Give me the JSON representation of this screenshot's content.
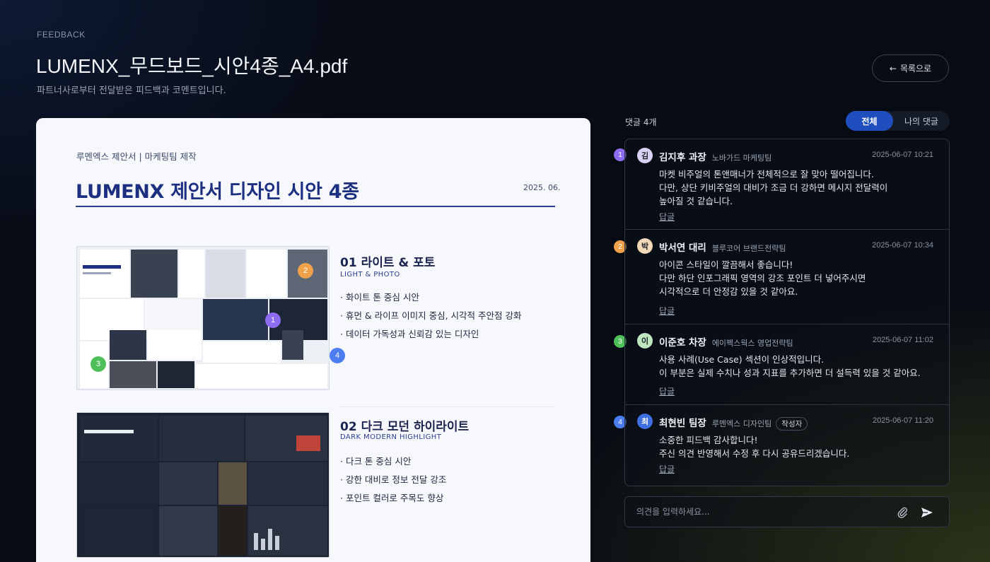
{
  "header": {
    "eyebrow": "FEEDBACK",
    "title": "LUMENX_무드보드_시안4종_A4.pdf",
    "subtitle": "파트너사로부터 전달받은 피드백과 코멘트입니다.",
    "back_label": "목록으로"
  },
  "document": {
    "eyebrow": "루멘엑스 제안서 | 마케팅팀 제작",
    "title": "LUMENX 제안서 디자인 시안 4종",
    "date": "2025. 06.",
    "sections": [
      {
        "heading": "01  라이트 & 포토",
        "sub": "LIGHT & PHOTO",
        "bullets": [
          "· 화이트 톤 중심 시안",
          "· 휴먼 & 라이프 이미지 중심, 시각적 주안점 강화",
          "· 데이터 가독성과 신뢰감 있는 디자인"
        ]
      },
      {
        "heading": "02  다크 모던 하이라이트",
        "sub": "DARK MODERN HIGHLIGHT",
        "bullets": [
          "· 다크 톤 중심 시안",
          "· 강한 대비로 정보 전달 강조",
          "· 포인트 컬러로 주목도 향상"
        ]
      }
    ],
    "pins": [
      "1",
      "2",
      "3",
      "4"
    ]
  },
  "comments_panel": {
    "count_label": "댓글 4개",
    "filter_all": "전체",
    "filter_mine": "나의 댓글",
    "comments": [
      {
        "pin": "1",
        "initial": "김",
        "name": "김지후 과장",
        "org": "노바가드 마케팅팀",
        "time": "2025-06-07 10:21",
        "text": "마켓 비주얼의 톤앤매너가 전체적으로 잘 맞아 떨어집니다.\n다만, 상단 키비주얼의 대비가 조금 더 강하면 메시지 전달력이\n높아질 것 같습니다.",
        "reply": "답글",
        "color": "#8e6cf0",
        "avatar_bg": "#d9d2f5"
      },
      {
        "pin": "2",
        "initial": "박",
        "name": "박서연 대리",
        "org": "블루코어 브랜드전략팀",
        "time": "2025-06-07 10:34",
        "text": "아이콘 스타일이 깔끔해서 좋습니다!\n다만 하단 인포그래픽 영역의 강조 포인트 더 넣어주시면\n시각적으로 더 안정감 있을 것 같아요.",
        "reply": "답글",
        "color": "#f0a24a",
        "avatar_bg": "#f3d9b8"
      },
      {
        "pin": "3",
        "initial": "이",
        "name": "이준호 차장",
        "org": "에이펙스웍스 영업전략팀",
        "time": "2025-06-07 11:02",
        "text": "사용 사례(Use Case) 섹션이 인상적입니다.\n이 부분은 실제 수치나 성과 지표를 추가하면 더 설득력 있을 것 같아요.",
        "reply": "답글",
        "color": "#4fbf5a",
        "avatar_bg": "#bfe6bf"
      },
      {
        "pin": "4",
        "initial": "최",
        "name": "최현빈 팀장",
        "org": "루멘엑스 디자인팀",
        "badge": "작성자",
        "time": "2025-06-07 11:20",
        "text": "소중한 피드백 감사합니다!\n주신 의견 반영해서 수정 후 다시 공유드리겠습니다.",
        "reply": "답글",
        "color": "#4d7cf0",
        "avatar_bg": "#3f6ee0"
      }
    ],
    "input_placeholder": "의견을 입력하세요..."
  }
}
